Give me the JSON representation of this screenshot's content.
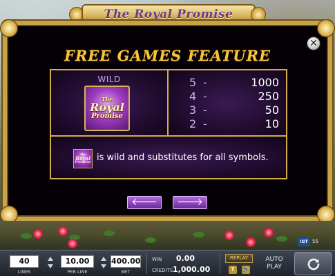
{
  "game": {
    "title": "The Royal Promise",
    "logo_text": {
      "the": "The",
      "royal": "Royal",
      "promise": "Promise"
    }
  },
  "paytable": {
    "heading": "FREE GAMES FEATURE",
    "wild_label": "WILD",
    "payouts": [
      {
        "count": "5",
        "dash": "-",
        "value": "1000"
      },
      {
        "count": "4",
        "dash": "-",
        "value": "250"
      },
      {
        "count": "3",
        "dash": "-",
        "value": "50"
      },
      {
        "count": "2",
        "dash": "-",
        "value": "10"
      }
    ],
    "description": "is wild and substitutes for all symbols."
  },
  "navigation": {
    "prev_icon": "left-arrow-icon",
    "next_icon": "right-arrow-icon",
    "close_icon": "close-icon"
  },
  "controls": {
    "lines_value": "40",
    "lines_label": "LINES",
    "perline_value": "10.00",
    "perline_label": "PER LINE",
    "bet_value": "400.00",
    "bet_label": "BET",
    "win_label": "WIN",
    "win_value": "0.00",
    "credits_label": "CREDITS",
    "credits_value": "1,000.00",
    "replay_label": "REPLAY",
    "help_label": "?",
    "auto_play_label_1": "AUTO",
    "auto_play_label_2": "PLAY",
    "sound_icon": "speaker-icon",
    "spin_icon": "spin-icon"
  },
  "branding": {
    "badge": "IGT",
    "rating": "55"
  },
  "colors": {
    "frame_gold": "#c9a348",
    "heading_gold": "#f7c43a",
    "panel_purple": "#3a1a52",
    "nav_button_purple": "#8a44c0"
  }
}
